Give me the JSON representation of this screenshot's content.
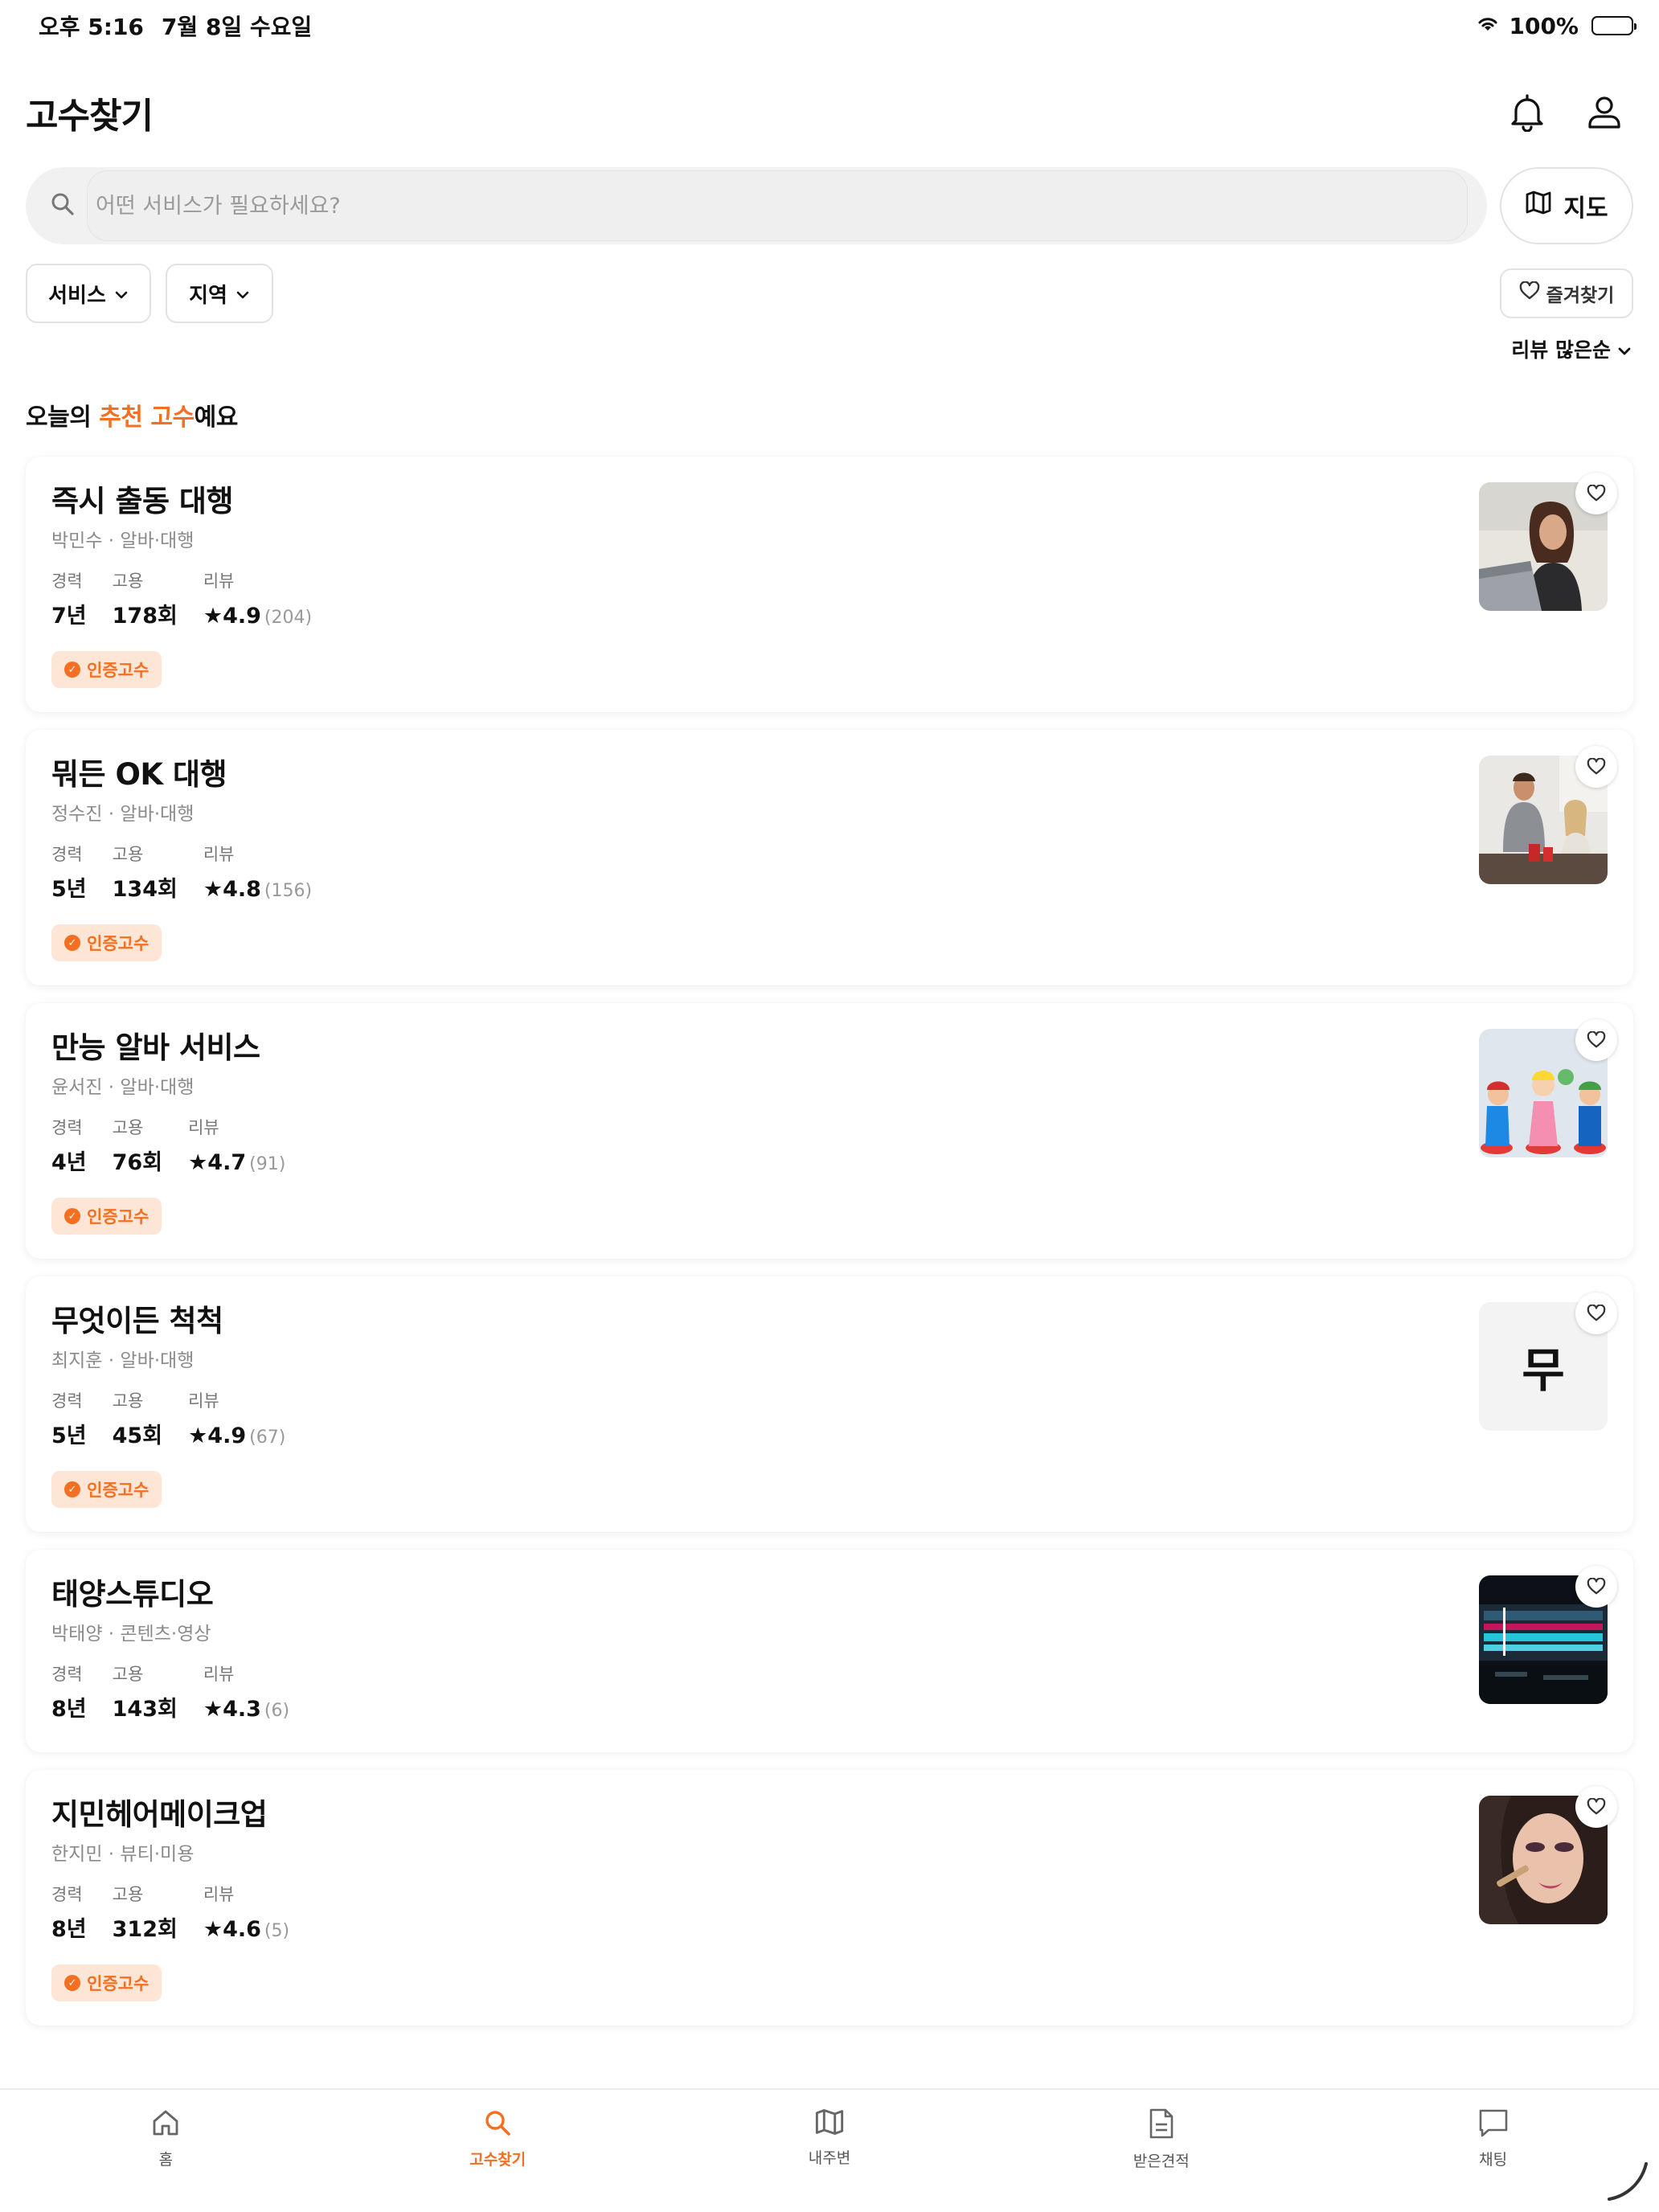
{
  "status_bar": {
    "time": "오후 5:16",
    "date": "7월 8일 수요일",
    "battery": "100%"
  },
  "header": {
    "title": "고수찾기",
    "icons": [
      "bell-icon",
      "user-icon"
    ]
  },
  "search": {
    "placeholder": "어떤 서비스가 필요하세요?",
    "value": "",
    "map_label": "지도"
  },
  "filters": {
    "service": "서비스",
    "region": "지역",
    "favorites": "즐겨찾기",
    "sort": "리뷰 많은순"
  },
  "section": {
    "prefix": "오늘의 ",
    "accent": "추천 고수",
    "suffix": "예요"
  },
  "stat_labels": {
    "career": "경력",
    "hires": "고용",
    "reviews": "리뷰"
  },
  "cards": [
    {
      "name": "즉시 출동 대행",
      "sub": "박민수 · 알바·대행",
      "career": "7년",
      "hires": "178회",
      "rating": "4.9",
      "count": "(204)",
      "badge": "인증고수",
      "image": "woman-laptop"
    },
    {
      "name": "뭐든 OK 대행",
      "sub": "정수진 · 알바·대행",
      "career": "5년",
      "hires": "134회",
      "rating": "4.8",
      "count": "(156)",
      "badge": "인증고수",
      "image": "couple-kitchen"
    },
    {
      "name": "만능 알바 서비스",
      "sub": "윤서진 · 알바·대행",
      "career": "4년",
      "hires": "76회",
      "rating": "4.7",
      "count": "(91)",
      "badge": "인증고수",
      "image": "toy-figures"
    },
    {
      "name": "무엇이든 척척",
      "sub": "최지훈 · 알바·대행",
      "career": "5년",
      "hires": "45회",
      "rating": "4.9",
      "count": "(67)",
      "badge": "인증고수",
      "image": "letter",
      "letter": "무"
    },
    {
      "name": "태양스튜디오",
      "sub": "박태양 · 콘텐츠·영상",
      "career": "8년",
      "hires": "143회",
      "rating": "4.3",
      "count": "(6)",
      "badge": "",
      "image": "video-editing"
    },
    {
      "name": "지민헤어메이크업",
      "sub": "한지민 · 뷰티·미용",
      "career": "8년",
      "hires": "312회",
      "rating": "4.6",
      "count": "(5)",
      "badge": "인증고수",
      "image": "makeup"
    }
  ],
  "tabs": [
    {
      "label": "홈",
      "icon": "home-icon",
      "active": false
    },
    {
      "label": "고수찾기",
      "icon": "search-icon",
      "active": true
    },
    {
      "label": "내주변",
      "icon": "map-icon",
      "active": false
    },
    {
      "label": "받은견적",
      "icon": "document-icon",
      "active": false
    },
    {
      "label": "채팅",
      "icon": "chat-icon",
      "active": false
    }
  ],
  "colors": {
    "accent": "#f36f21",
    "badge_bg": "#fde6d5",
    "search_bg": "#f1f1f1"
  }
}
